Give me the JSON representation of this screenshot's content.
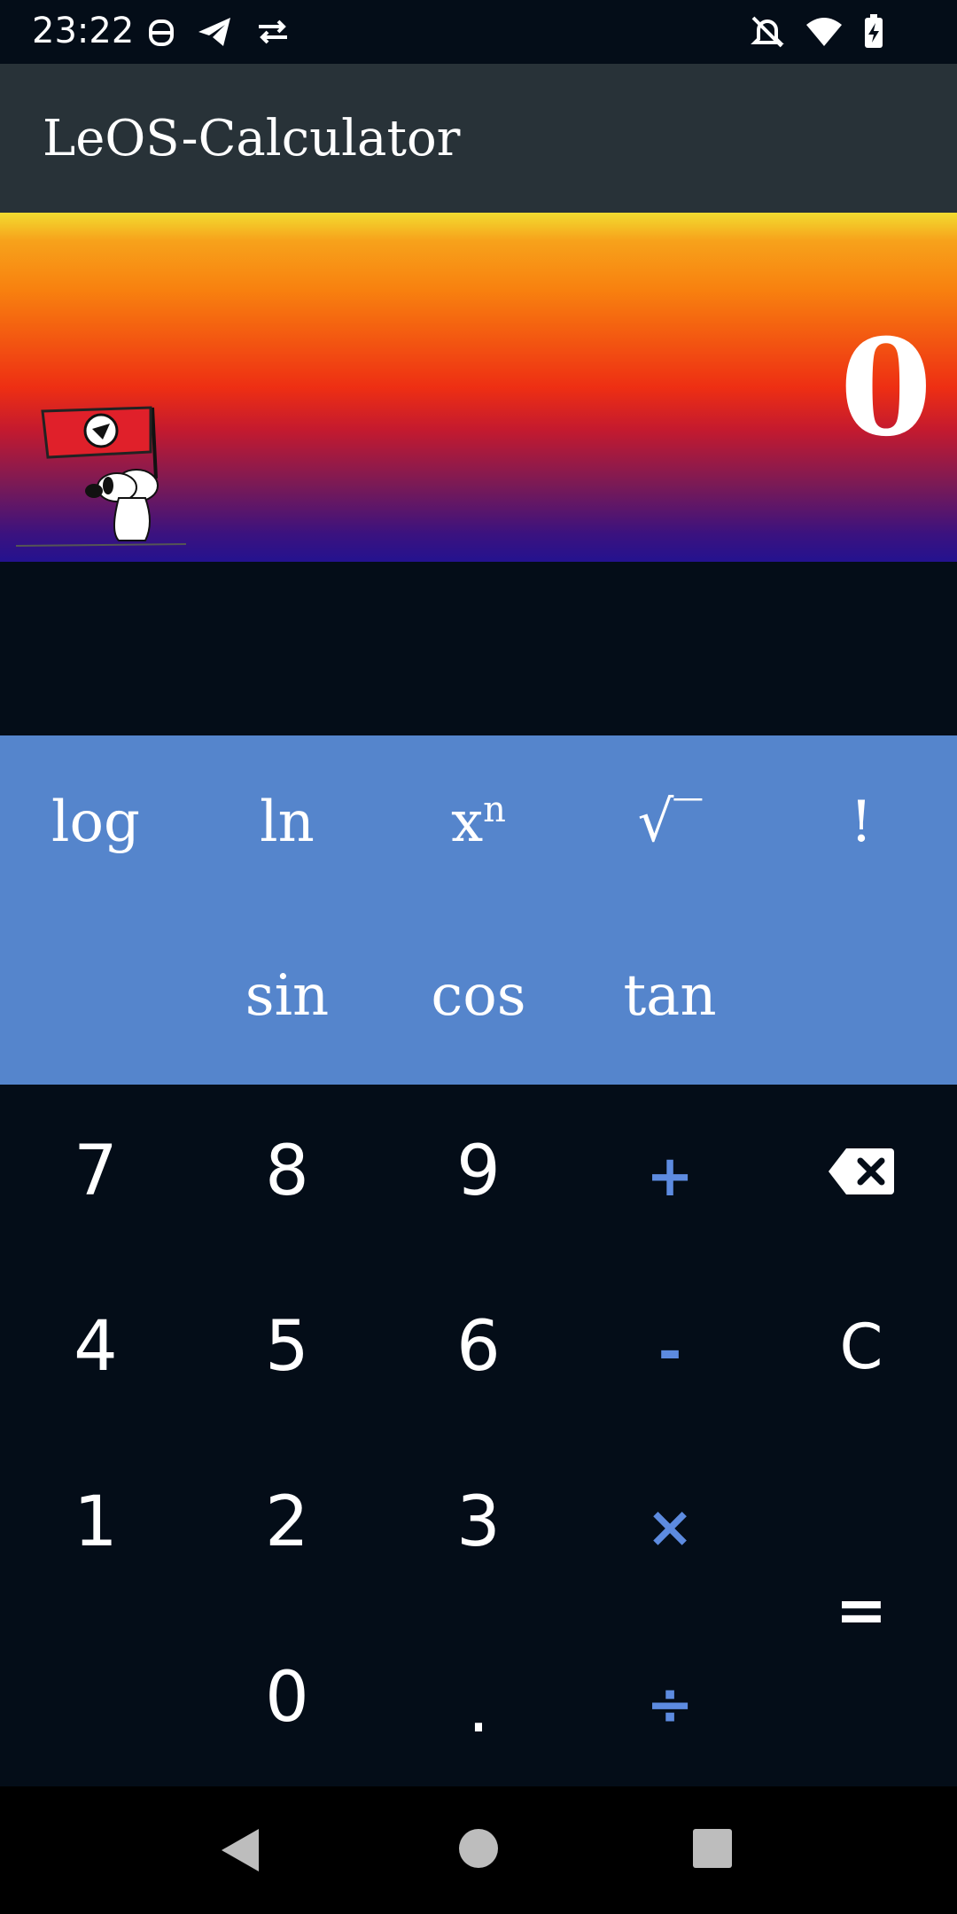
{
  "status_bar": {
    "time": "23:22",
    "icons": [
      "vpn-icon",
      "telegram-icon",
      "data-transfer-icon",
      "notifications-off-icon",
      "wifi-icon",
      "battery-charging-icon"
    ]
  },
  "app_bar": {
    "title": "LeOS-Calculator"
  },
  "display": {
    "value": "0"
  },
  "scientific": {
    "row1": [
      "log",
      "ln",
      "x",
      "√‾",
      "!"
    ],
    "xn_sup": "n",
    "row2": [
      "sin",
      "cos",
      "tan"
    ]
  },
  "keypad": {
    "digits": {
      "seven": "7",
      "eight": "8",
      "nine": "9",
      "four": "4",
      "five": "5",
      "six": "6",
      "one": "1",
      "two": "2",
      "three": "3",
      "zero": "0",
      "dot": "."
    },
    "ops": {
      "plus": "+",
      "minus": "-",
      "times": "×",
      "divide": "÷",
      "equals": "=",
      "clear": "C"
    }
  },
  "colors": {
    "accent": "#5d8be0",
    "sci_panel": "#5585cc",
    "app_bar": "#283238",
    "background": "#040d18"
  },
  "nav_bar": {
    "icons": [
      "back-icon",
      "home-icon",
      "recents-icon"
    ]
  }
}
